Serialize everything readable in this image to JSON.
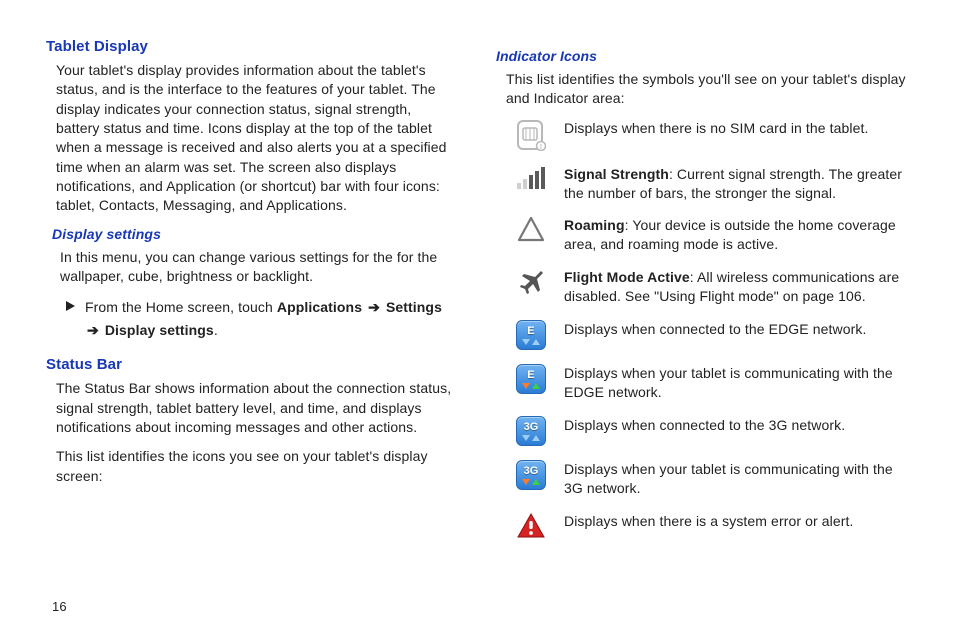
{
  "page_number": "16",
  "left": {
    "h1_tablet": "Tablet Display",
    "p_tablet": "Your tablet's display provides information about the tablet's status, and is the interface to the features of your tablet. The display indicates your connection status, signal strength, battery status and time. Icons display at the top of the tablet when a message is received and also alerts you at a specified time when an alarm was set. The screen also displays notifications, and Application (or shortcut) bar with four icons: tablet, Contacts, Messaging, and Applications.",
    "h2_display_settings": "Display settings",
    "p_display_settings": "In this menu, you can change various settings for the for the wallpaper, cube, brightness or backlight.",
    "step_prefix": "From the Home screen, touch ",
    "step_b1": "Applications",
    "step_b2": "Settings",
    "step_b3": "Display settings",
    "h1_status": "Status Bar",
    "p_status1": "The Status Bar shows information about the connection status, signal strength, tablet battery level, and time, and displays notifications about incoming messages and other actions.",
    "p_status2": "This list identifies the icons you see on your tablet's display screen:"
  },
  "right": {
    "h2_indicator": "Indicator Icons",
    "p_indicator": "This list identifies the symbols you'll see on your tablet's display and Indicator area:",
    "items": [
      {
        "icon": "sim",
        "desc_plain": "Displays when there is no SIM card in the tablet."
      },
      {
        "icon": "signal",
        "bold": "Signal Strength",
        "desc_after": ": Current signal strength. The greater the number of bars, the stronger the signal."
      },
      {
        "icon": "roaming",
        "bold": "Roaming",
        "desc_after": ": Your device is outside the home coverage area, and roaming mode is active."
      },
      {
        "icon": "flight",
        "bold": "Flight Mode Active",
        "desc_after": ": All wireless communications are disabled. See \"Using Flight mode\" on page 106."
      },
      {
        "icon": "edge-idle",
        "desc_plain": "Displays when connected to the EDGE network."
      },
      {
        "icon": "edge-active",
        "desc_plain": "Displays when your tablet is communicating with the EDGE network."
      },
      {
        "icon": "3g-idle",
        "desc_plain": "Displays when connected to the 3G network."
      },
      {
        "icon": "3g-active",
        "desc_plain": "Displays when your tablet is communicating with the 3G network."
      },
      {
        "icon": "alert",
        "desc_plain": "Displays when there is a system error or alert."
      }
    ]
  }
}
